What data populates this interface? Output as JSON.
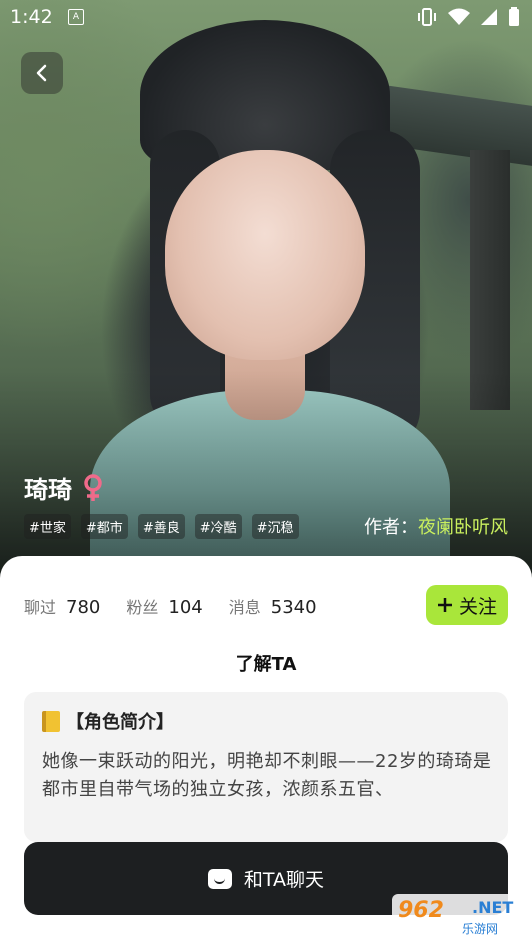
{
  "status_bar": {
    "time": "1:42",
    "notification_glyph": "A"
  },
  "profile": {
    "name": "琦琦",
    "gender_icon": "female-icon",
    "tags": [
      "#世家",
      "#都市",
      "#善良",
      "#冷酷",
      "#沉稳"
    ],
    "author_label": "作者：",
    "author_name": "夜阑卧听风"
  },
  "stats": [
    {
      "label": "聊过",
      "value": "780"
    },
    {
      "label": "粉丝",
      "value": "104"
    },
    {
      "label": "消息",
      "value": "5340"
    }
  ],
  "follow_button": {
    "icon": "plus-icon",
    "label": "关注"
  },
  "section_title": "了解TA",
  "intro": {
    "title": "【角色简介】",
    "text": "她像一束跃动的阳光，明艳却不刺眼——22岁的琦琦是都市里自带气场的独立女孩，浓颜系五官、"
  },
  "chat_button": {
    "label": "和TA聊天"
  },
  "watermark": {
    "logo": "962",
    "net": ".NET",
    "sub": "乐游网"
  },
  "colors": {
    "accent_green": "#a9e63a",
    "author_green": "#c9ef5e",
    "female_pink": "#f06a8a",
    "chat_button_bg": "#1d1f21"
  }
}
